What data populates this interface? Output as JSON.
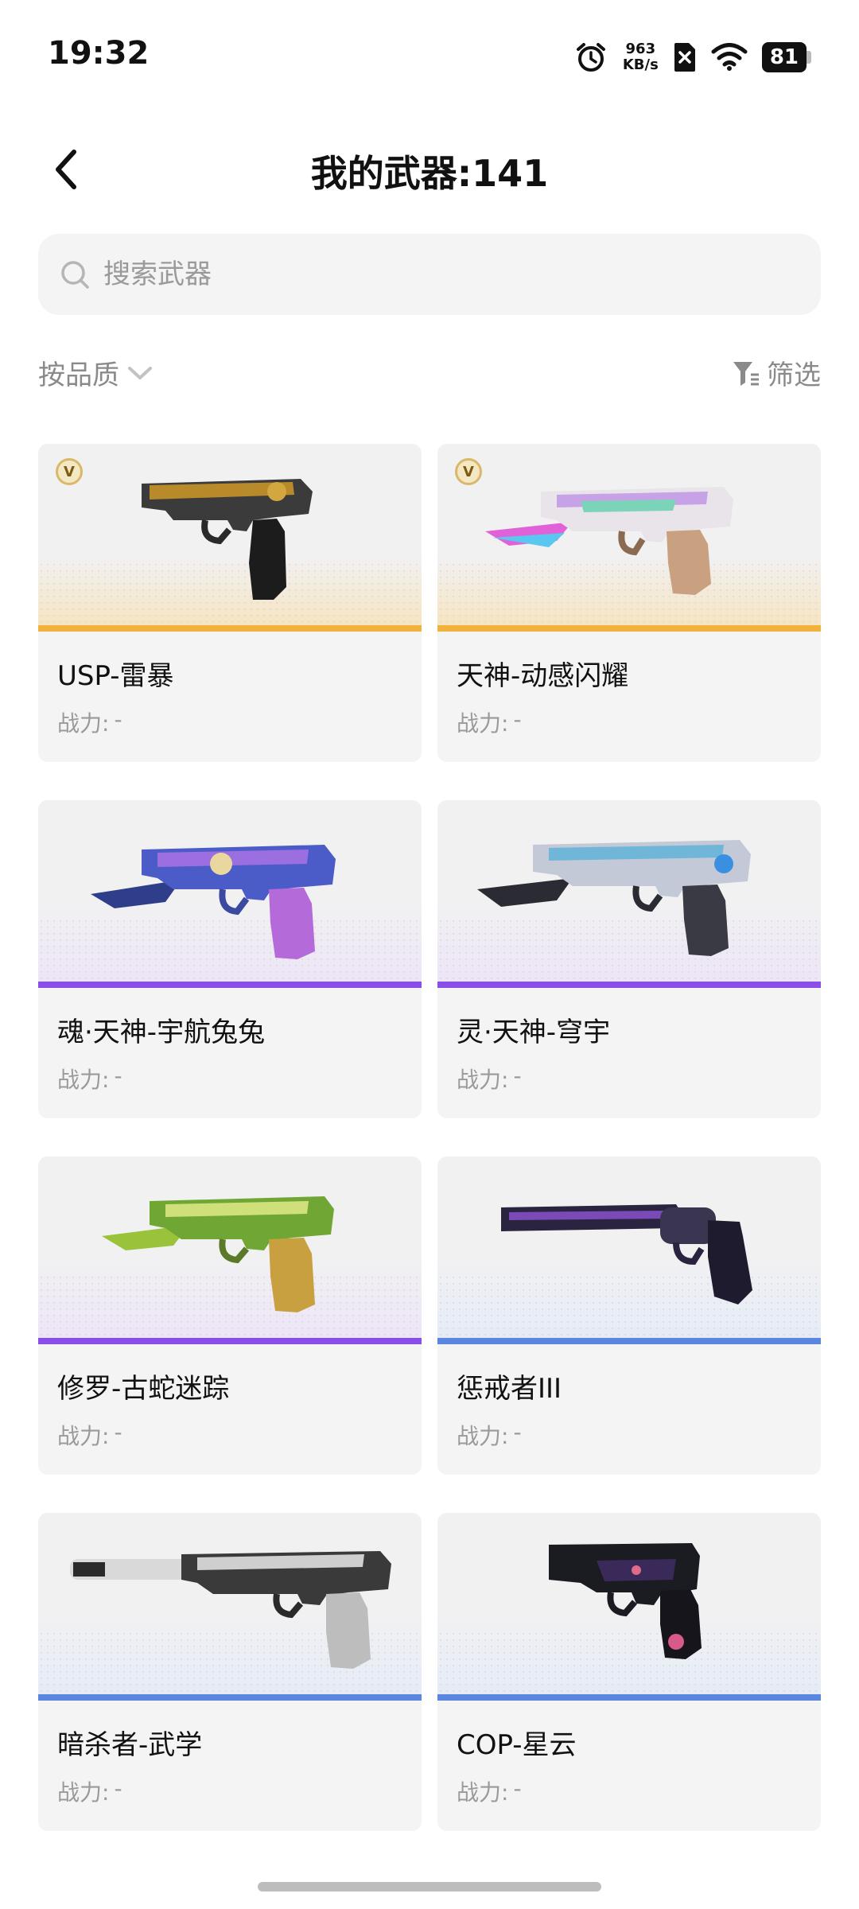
{
  "status": {
    "time": "19:32",
    "net_speed_value": "963",
    "net_speed_unit": "KB/s",
    "battery": "81"
  },
  "header": {
    "title": "我的武器:141"
  },
  "search": {
    "placeholder": "搜索武器"
  },
  "sort": {
    "label": "按品质"
  },
  "filter": {
    "label": "筛选"
  },
  "colors": {
    "gold": "#f0b23a",
    "purple": "#8a4de8",
    "blue": "#5a86e0"
  },
  "weapons": [
    {
      "name": "USP-雷暴",
      "power_label": "战力:",
      "power_value": "-",
      "badge": "V",
      "quality_color": "#f0b23a"
    },
    {
      "name": "天神-动感闪耀",
      "power_label": "战力:",
      "power_value": "-",
      "badge": "V",
      "quality_color": "#f0b23a"
    },
    {
      "name": "魂·天神-宇航兔兔",
      "power_label": "战力:",
      "power_value": "-",
      "quality_color": "#8a4de8"
    },
    {
      "name": "灵·天神-穹宇",
      "power_label": "战力:",
      "power_value": "-",
      "quality_color": "#8a4de8"
    },
    {
      "name": "修罗-古蛇迷踪",
      "power_label": "战力:",
      "power_value": "-",
      "quality_color": "#8a4de8"
    },
    {
      "name": "惩戒者III",
      "power_label": "战力:",
      "power_value": "-",
      "quality_color": "#5a86e0"
    },
    {
      "name": "暗杀者-武学",
      "power_label": "战力:",
      "power_value": "-",
      "quality_color": "#5a86e0"
    },
    {
      "name": "COP-星云",
      "power_label": "战力:",
      "power_value": "-",
      "quality_color": "#5a86e0"
    }
  ]
}
